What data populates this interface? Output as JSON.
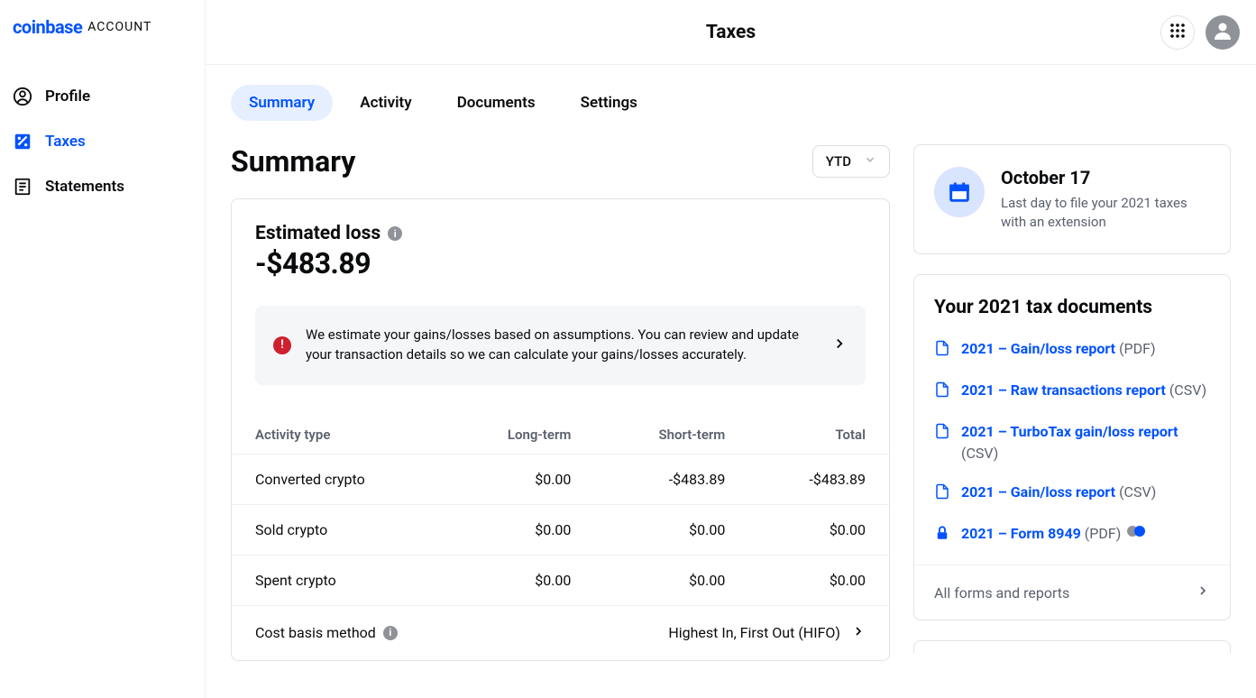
{
  "brand": {
    "name": "coinbase",
    "sub": "ACCOUNT"
  },
  "page_title": "Taxes",
  "sidebar": {
    "items": [
      {
        "label": "Profile"
      },
      {
        "label": "Taxes"
      },
      {
        "label": "Statements"
      }
    ]
  },
  "tabs": [
    {
      "label": "Summary",
      "active": true
    },
    {
      "label": "Activity",
      "active": false
    },
    {
      "label": "Documents",
      "active": false
    },
    {
      "label": "Settings",
      "active": false
    }
  ],
  "summary": {
    "heading": "Summary",
    "period": "YTD",
    "estimate_label": "Estimated loss",
    "estimate_value": "-$483.89",
    "notice_text": "We estimate your gains/losses based on assumptions. You can review and update your transaction details so we can calculate your gains/losses accurately.",
    "columns": [
      "Activity type",
      "Long-term",
      "Short-term",
      "Total"
    ],
    "rows": [
      {
        "type": "Converted crypto",
        "long": "$0.00",
        "short": "-$483.89",
        "total": "-$483.89"
      },
      {
        "type": "Sold crypto",
        "long": "$0.00",
        "short": "$0.00",
        "total": "$0.00"
      },
      {
        "type": "Spent crypto",
        "long": "$0.00",
        "short": "$0.00",
        "total": "$0.00"
      }
    ],
    "cost_basis_label": "Cost basis method",
    "cost_basis_value": "Highest In, First Out (HIFO)"
  },
  "deadline": {
    "date": "October 17",
    "text": "Last day to file your 2021 taxes with an extension"
  },
  "documents": {
    "title": "Your 2021 tax documents",
    "items": [
      {
        "name": "2021 – Gain/loss report",
        "type": "(PDF)",
        "locked": false
      },
      {
        "name": "2021 – Raw transactions report",
        "type": "(CSV)",
        "locked": false
      },
      {
        "name": "2021 – TurboTax gain/loss report",
        "type": "(CSV)",
        "locked": false
      },
      {
        "name": "2021 – Gain/loss report",
        "type": "(CSV)",
        "locked": false
      },
      {
        "name": "2021 – Form 8949",
        "type": "(PDF)",
        "locked": true
      }
    ],
    "all_forms_label": "All forms and reports"
  }
}
